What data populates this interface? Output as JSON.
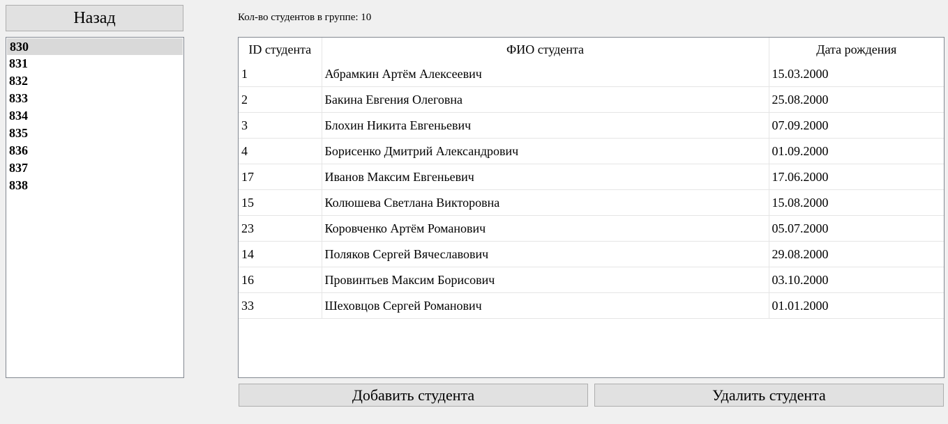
{
  "back_button": {
    "label": "Назад"
  },
  "groups": {
    "items": [
      "830",
      "831",
      "832",
      "833",
      "834",
      "835",
      "836",
      "837",
      "838"
    ],
    "selected": "830"
  },
  "count_label": "Кол-во студентов в группе: 10",
  "table": {
    "headers": [
      "ID студента",
      "ФИО студента",
      "Дата рождения"
    ],
    "rows": [
      [
        "1",
        "Абрамкин Артём Алексеевич",
        "15.03.2000"
      ],
      [
        "2",
        "Бакина Евгения Олеговна",
        "25.08.2000"
      ],
      [
        "3",
        "Блохин Никита Евгеньевич",
        "07.09.2000"
      ],
      [
        "4",
        "Борисенко Дмитрий Александрович",
        "01.09.2000"
      ],
      [
        "17",
        "Иванов Максим Евгеньевич",
        "17.06.2000"
      ],
      [
        "15",
        "Колюшева Светлана Викторовна",
        "15.08.2000"
      ],
      [
        "23",
        "Коровченко Артём Романович",
        "05.07.2000"
      ],
      [
        "14",
        "Поляков Сергей Вячеславович",
        "29.08.2000"
      ],
      [
        "16",
        "Провинтьев Максим Борисович",
        "03.10.2000"
      ],
      [
        "33",
        "Шеховцов Сергей Романович",
        "01.01.2000"
      ]
    ]
  },
  "actions": {
    "add_label": "Добавить студента",
    "delete_label": "Удалить студента"
  }
}
